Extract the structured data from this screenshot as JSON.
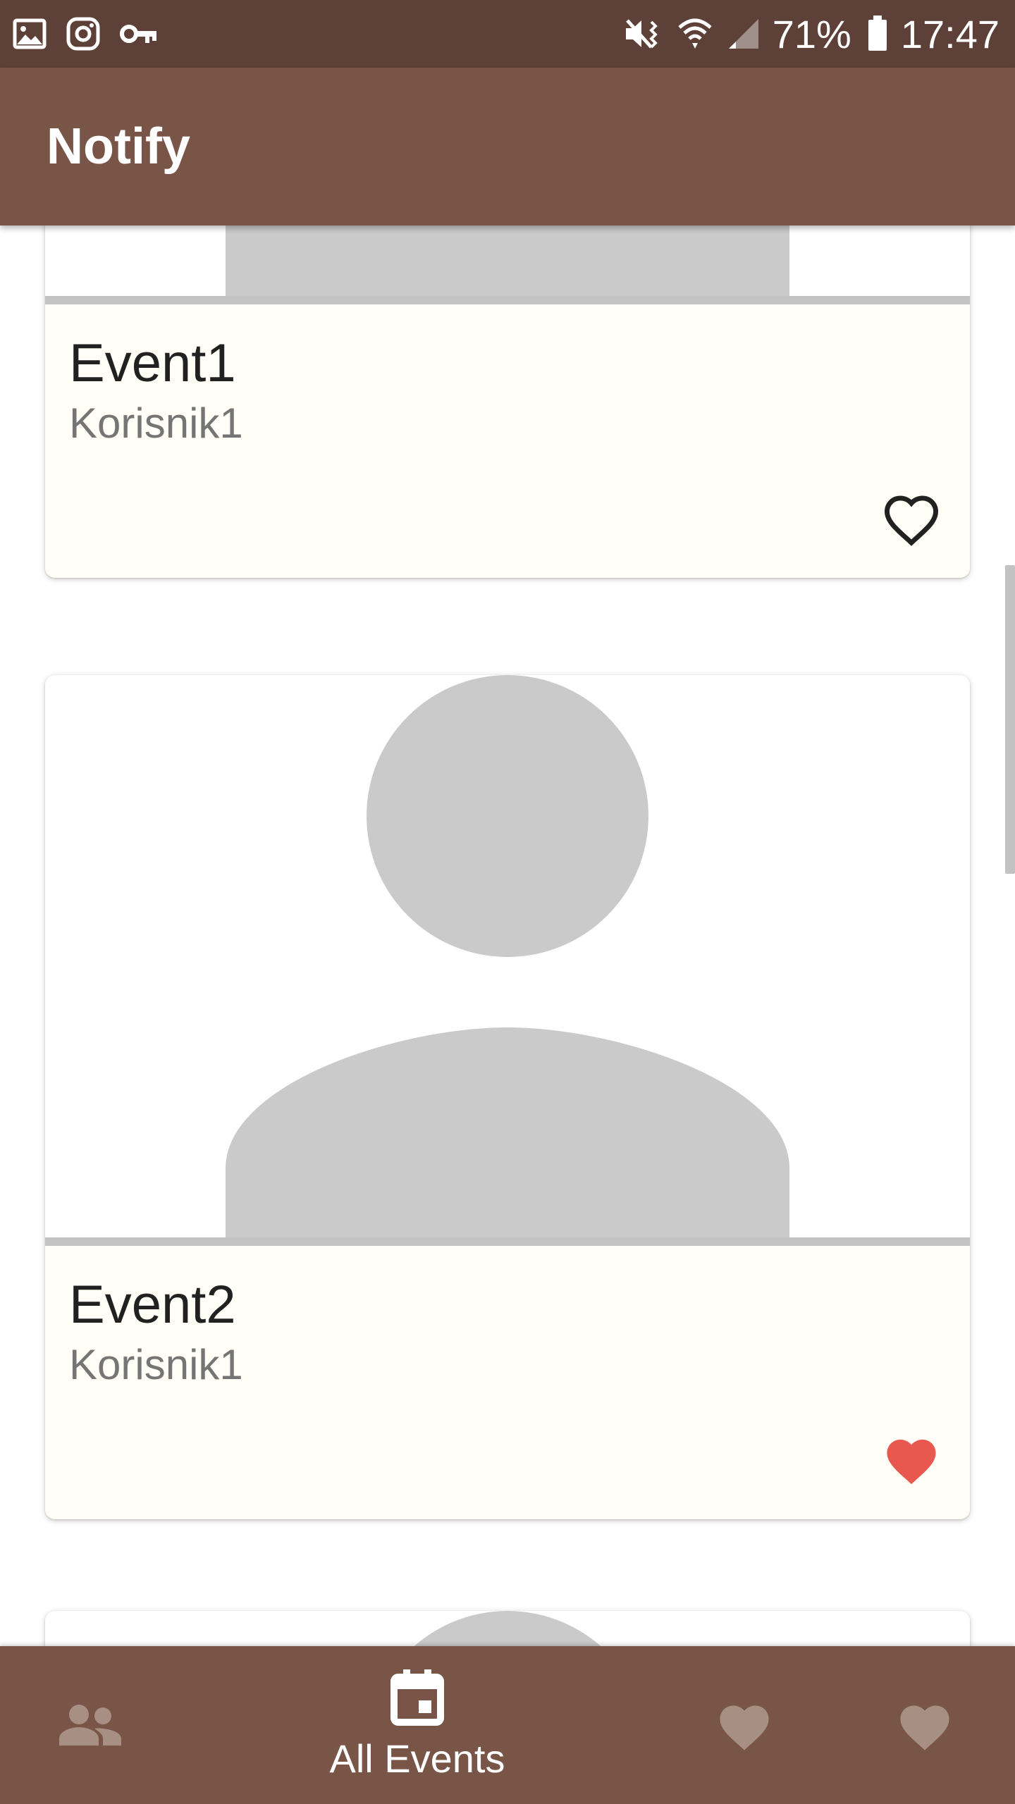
{
  "status_bar": {
    "battery": "71%",
    "time": "17:47",
    "left_icons": [
      "image-icon",
      "instagram-icon",
      "key-icon"
    ],
    "right_icons": [
      "vibrate-mute-icon",
      "wifi-icon",
      "signal-icon",
      "battery-icon"
    ]
  },
  "app_bar": {
    "title": "Notify"
  },
  "events": [
    {
      "title": "Event1",
      "author": "Korisnik1",
      "favorite": false
    },
    {
      "title": "Event2",
      "author": "Korisnik1",
      "favorite": true
    }
  ],
  "bottom_nav": {
    "items": [
      {
        "icon": "people-icon",
        "label": "",
        "active": false
      },
      {
        "icon": "calendar-icon",
        "label": "All Events",
        "active": true
      },
      {
        "icon": "heart-icon",
        "label": "",
        "active": false
      },
      {
        "icon": "heart-icon",
        "label": "",
        "active": false
      }
    ]
  },
  "colors": {
    "status_bar": "#5d4037",
    "primary": "#795548",
    "card_body": "#fffef7",
    "favorite_active": "#e8584e",
    "placeholder": "#cacaca"
  }
}
